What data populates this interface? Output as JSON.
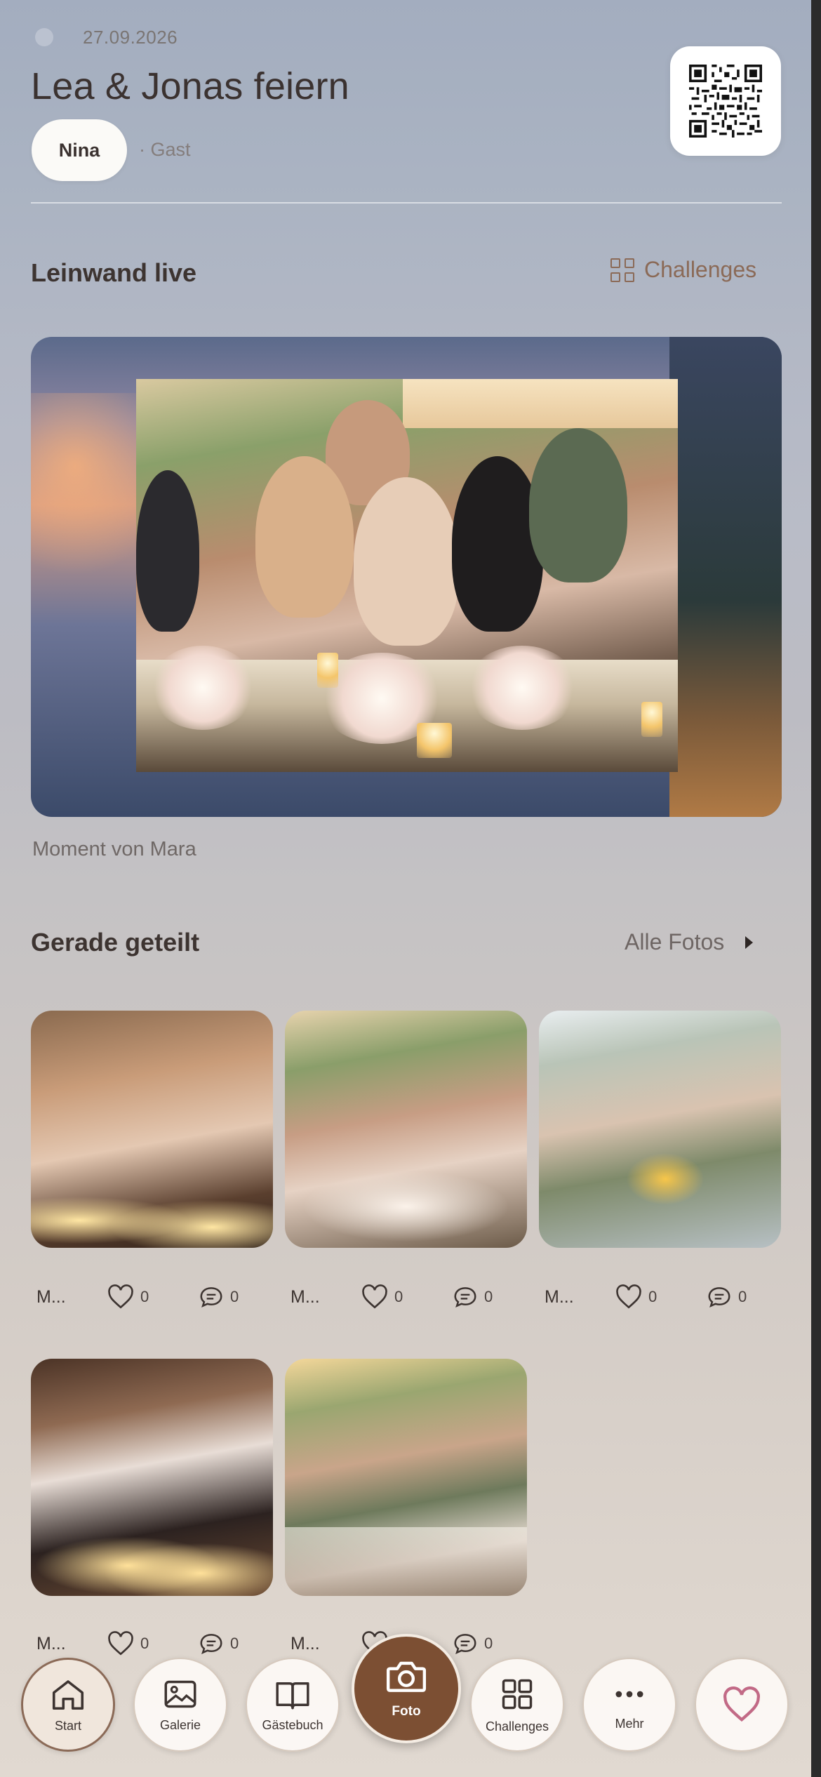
{
  "header": {
    "date": "27.09.2026",
    "title": "Lea & Jonas feiern",
    "user_name": "Nina",
    "user_role": "· Gast",
    "qr_icon": "qr-code-icon"
  },
  "live_section": {
    "title": "Leinwand live",
    "challenges_link": "Challenges",
    "caption": "Moment von Mara"
  },
  "shared_section": {
    "title": "Gerade geteilt",
    "all_photos_link": "Alle Fotos",
    "photos": [
      {
        "user": "M...",
        "likes": "0",
        "comments": "0"
      },
      {
        "user": "M...",
        "likes": "0",
        "comments": "0"
      },
      {
        "user": "M...",
        "likes": "0",
        "comments": "0"
      },
      {
        "user": "M...",
        "likes": "0",
        "comments": "0"
      },
      {
        "user": "M...",
        "likes": "0",
        "comments": "0"
      }
    ]
  },
  "nav": {
    "start": "Start",
    "galerie": "Galerie",
    "gaestebuch": "Gästebuch",
    "foto": "Foto",
    "challenges": "Challenges",
    "mehr": "Mehr"
  },
  "colors": {
    "accent": "#7c4f33",
    "link": "#8b6a57"
  }
}
